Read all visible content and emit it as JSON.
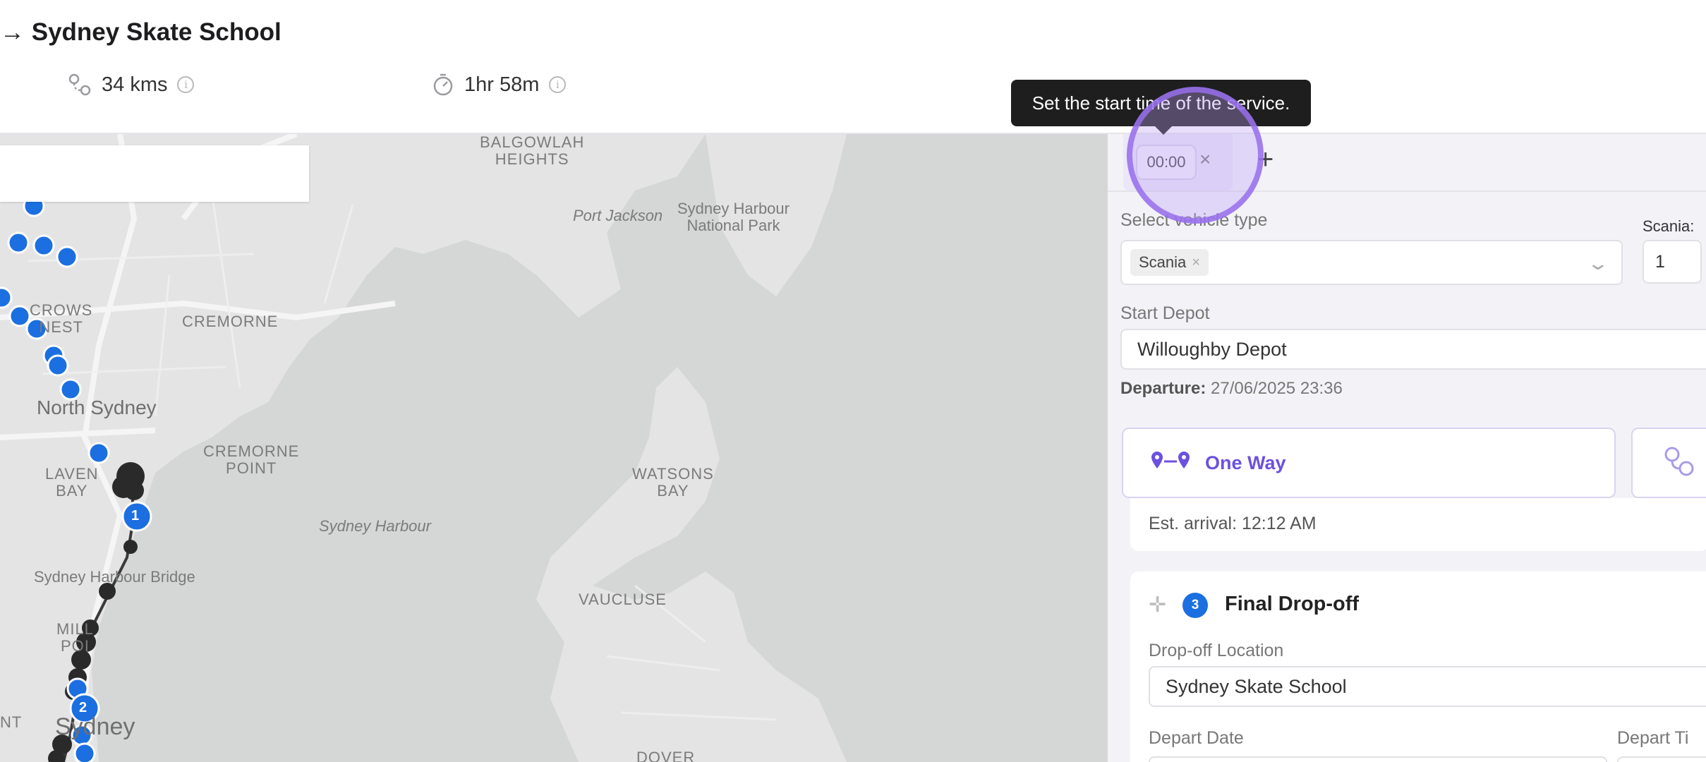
{
  "header": {
    "route_title": "→ Sydney Skate School",
    "distance": "34 kms",
    "duration": "1hr 58m"
  },
  "map": {
    "labels": {
      "balgowlah": "BALGOWLAH\nHEIGHTS",
      "port_jackson": "Port Jackson",
      "sydney_harbour_np": "Sydney Harbour\nNational Park",
      "crows_nest": "CROWS\nNEST",
      "cremorne": "CREMORNE",
      "north_sydney": "North Sydney",
      "cremorne_point": "CREMORNE\nPOINT",
      "lavender_bay": "LAVEN\nBAY",
      "watsons_bay": "WATSONS\nBAY",
      "sydney_harbour": "Sydney Harbour",
      "sydney_harbour_bridge": "Sydney Harbour Bridge",
      "vaucluse": "VAUCLUSE",
      "milsons_point": "MILL\nPOI",
      "sydney": "Sydney",
      "dover": "DOVER",
      "left_edge": "NT"
    },
    "markers": [
      "1",
      "2"
    ],
    "colors": {
      "stop_blue": "#1b6fe0",
      "route_dark": "#2a2a2a"
    }
  },
  "tooltip": {
    "text": "Set the start time of the service."
  },
  "panel": {
    "time_chip": "00:00",
    "clear_icon": "×",
    "add_icon": "+",
    "vehicle_type_label": "Select vehicle type",
    "vehicle_tag": "Scania",
    "vehicle_count_label": "Scania:",
    "vehicle_count": "1",
    "start_depot_label": "Start Depot",
    "start_depot_value": "Willoughby Depot",
    "departure_label": "Departure:",
    "departure_value": "27/06/2025 23:36",
    "trip_mode": "One Way",
    "est_arrival": "Est. arrival: 12:12 AM",
    "stop": {
      "number": "3",
      "title": "Final Drop-off",
      "location_label": "Drop-off Location",
      "location_value": "Sydney Skate School",
      "depart_date_label": "Depart Date",
      "depart_time_label": "Depart Ti"
    },
    "accent_color": "#6b51e0"
  }
}
